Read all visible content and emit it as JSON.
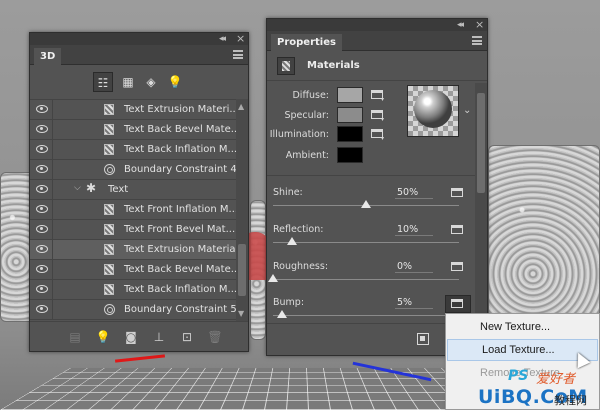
{
  "panel_3d": {
    "tab_label": "3D",
    "filters": [
      "whole-scene-icon",
      "mesh-icon",
      "material-icon",
      "light-icon"
    ],
    "layers": [
      {
        "name": "Text Extrusion Materi...",
        "icon": "material-icon",
        "selected": false
      },
      {
        "name": "Text Back Bevel Mate...",
        "icon": "material-icon",
        "selected": false
      },
      {
        "name": "Text Back Inflation M...",
        "icon": "material-icon",
        "selected": false
      },
      {
        "name": "Boundary Constraint 4",
        "icon": "constraint-icon",
        "selected": false
      },
      {
        "name": "Text",
        "icon": "mesh-icon",
        "selected": false,
        "group": true
      },
      {
        "name": "Text Front Inflation M...",
        "icon": "material-icon",
        "selected": false
      },
      {
        "name": "Text Front Bevel Mat...",
        "icon": "material-icon",
        "selected": false
      },
      {
        "name": "Text Extrusion Material",
        "icon": "material-icon",
        "selected": true
      },
      {
        "name": "Text Back Bevel Mate...",
        "icon": "material-icon",
        "selected": false
      },
      {
        "name": "Text Back Inflation M...",
        "icon": "material-icon",
        "selected": false
      },
      {
        "name": "Boundary Constraint 5",
        "icon": "constraint-icon",
        "selected": false
      }
    ]
  },
  "properties": {
    "tab_label": "Properties",
    "section_title": "Materials",
    "colors": {
      "diffuse_label": "Diffuse:",
      "specular_label": "Specular:",
      "illumination_label": "Illumination:",
      "ambient_label": "Ambient:",
      "diffuse": "#a6a6a6",
      "specular": "#8c8c8c",
      "illumination": "#000000",
      "ambient": "#000000"
    },
    "sliders": {
      "shine": {
        "label": "Shine:",
        "value": "50%",
        "level": 0.5
      },
      "reflection": {
        "label": "Reflection:",
        "value": "10%",
        "level": 0.1
      },
      "roughness": {
        "label": "Roughness:",
        "value": "0%",
        "level": 0.0
      },
      "bump": {
        "label": "Bump:",
        "value": "5%",
        "level": 0.05
      }
    }
  },
  "context_menu": {
    "new_texture": "New Texture...",
    "load_texture": "Load Texture...",
    "remove_texture": "Remove Texture"
  },
  "watermark": {
    "ps": "PS",
    "cn1": "爱好者",
    "main": "UiBQ.CoM",
    "cn2": "教程网"
  }
}
